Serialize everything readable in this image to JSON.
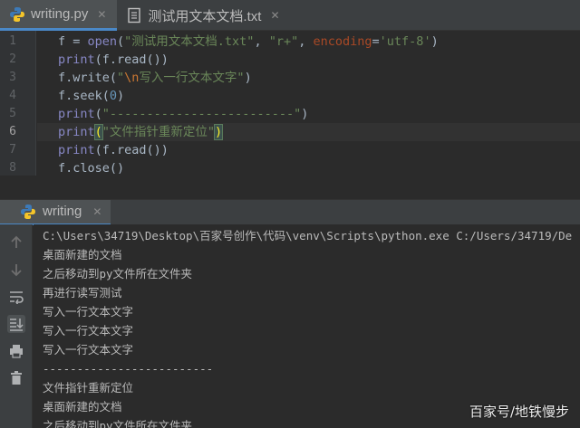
{
  "tabs": [
    {
      "label": "writing.py",
      "icon": "python-file-icon",
      "active": true
    },
    {
      "label": "测试用文本文档.txt",
      "icon": "text-file-icon",
      "active": false
    }
  ],
  "editor": {
    "line_numbers": [
      "1",
      "2",
      "3",
      "4",
      "5",
      "6",
      "7",
      "8"
    ],
    "current_line": 6
  },
  "run_panel": {
    "tab_label": "writing",
    "command": "C:\\Users\\34719\\Desktop\\百家号创作\\代码\\venv\\Scripts\\python.exe C:/Users/34719/De",
    "output": [
      "桌面新建的文档",
      "之后移动到py文件所在文件夹",
      "再进行读写测试",
      "写入一行文本文字",
      "写入一行文本文字",
      "写入一行文本文字",
      "-------------------------",
      "文件指针重新定位",
      "桌面新建的文档",
      "之后移动到py文件所在文件夹"
    ]
  },
  "watermark": "百家号/地铁慢步",
  "colors": {
    "accent": "#4a88c7",
    "string": "#6a8759",
    "keyword": "#8888c6",
    "number": "#6897bb",
    "param": "#aa4926"
  }
}
